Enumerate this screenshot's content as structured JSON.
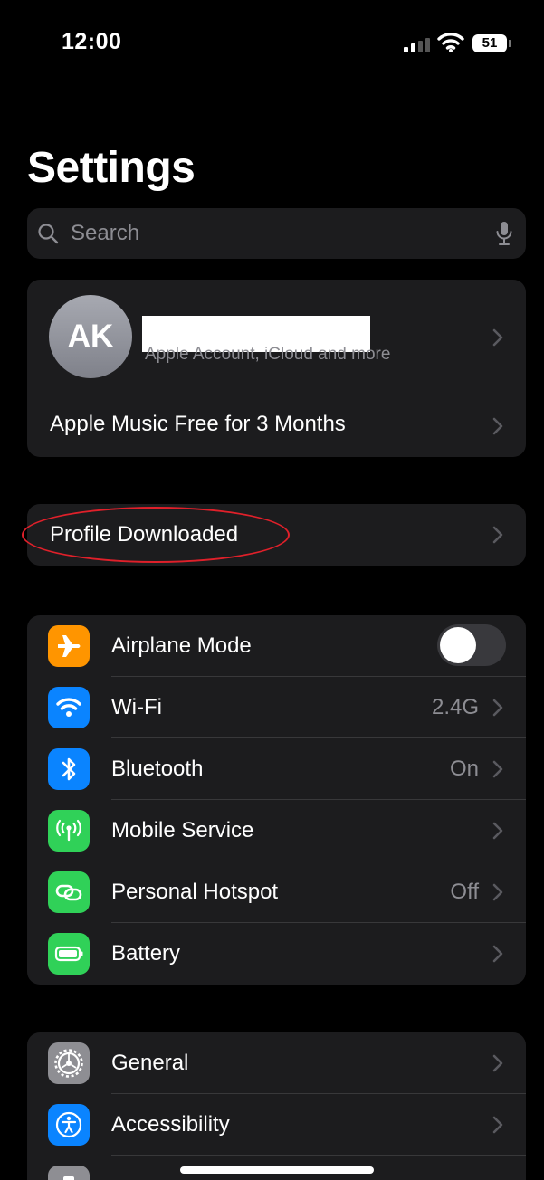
{
  "status_bar": {
    "time": "12:00",
    "battery_level": "51"
  },
  "header": {
    "title": "Settings"
  },
  "search": {
    "placeholder": "Search"
  },
  "account": {
    "initials": "AK",
    "subtitle": "Apple Account, iCloud and more",
    "promo": "Apple Music Free for 3 Months"
  },
  "profile": {
    "label": "Profile Downloaded"
  },
  "connectivity": {
    "airplane_mode": {
      "label": "Airplane Mode",
      "toggle": "off",
      "icon": "airplane-icon",
      "color": "#ff9500"
    },
    "wifi": {
      "label": "Wi-Fi",
      "value": "2.4G",
      "icon": "wifi-icon",
      "color": "#0a84ff"
    },
    "bluetooth": {
      "label": "Bluetooth",
      "value": "On",
      "icon": "bluetooth-icon",
      "color": "#0a84ff"
    },
    "mobile_service": {
      "label": "Mobile Service",
      "icon": "antenna-icon",
      "color": "#30d158"
    },
    "personal_hotspot": {
      "label": "Personal Hotspot",
      "value": "Off",
      "icon": "link-icon",
      "color": "#30d158"
    },
    "battery": {
      "label": "Battery",
      "icon": "battery-icon",
      "color": "#30d158"
    }
  },
  "general_group": {
    "general": {
      "label": "General",
      "icon": "gear-icon",
      "color": "#8e8e93"
    },
    "accessibility": {
      "label": "Accessibility",
      "icon": "accessibility-icon",
      "color": "#0a84ff"
    },
    "next_item": {
      "icon": "camera-icon",
      "color": "#8e8e93"
    }
  },
  "annotation": {
    "color": "#e0202a",
    "shape": "ellipse around Profile Downloaded"
  }
}
